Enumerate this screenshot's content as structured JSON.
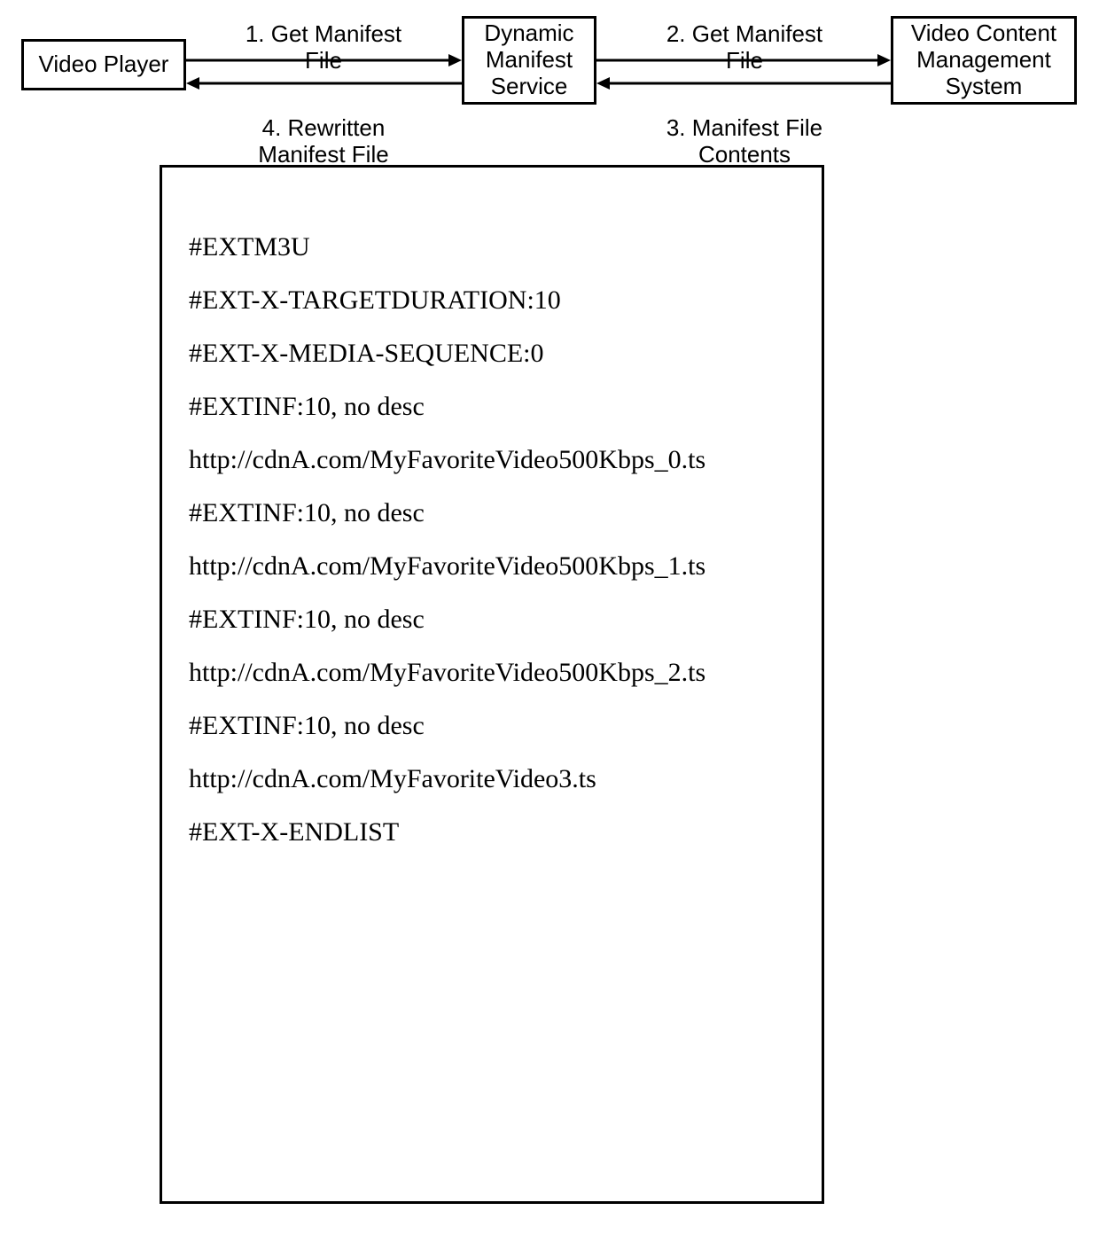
{
  "nodes": {
    "video_player": "Video Player",
    "dynamic_manifest_service": "Dynamic\nManifest\nService",
    "video_cms": "Video Content\nManagement\nSystem"
  },
  "flows": {
    "step1": "1. Get Manifest\nFile",
    "step2": "2. Get Manifest\nFile",
    "step3": "3. Manifest File\nContents",
    "step4": "4. Rewritten\nManifest File"
  },
  "manifest": {
    "lines": [
      "#EXTM3U",
      "#EXT-X-TARGETDURATION:10",
      "#EXT-X-MEDIA-SEQUENCE:0",
      "#EXTINF:10, no desc",
      "http://cdnA.com/MyFavoriteVideo500Kbps_0.ts",
      "#EXTINF:10, no desc",
      "http://cdnA.com/MyFavoriteVideo500Kbps_1.ts",
      "#EXTINF:10, no desc",
      "http://cdnA.com/MyFavoriteVideo500Kbps_2.ts",
      "#EXTINF:10, no desc",
      "http://cdnA.com/MyFavoriteVideo3.ts",
      "#EXT-X-ENDLIST"
    ]
  }
}
